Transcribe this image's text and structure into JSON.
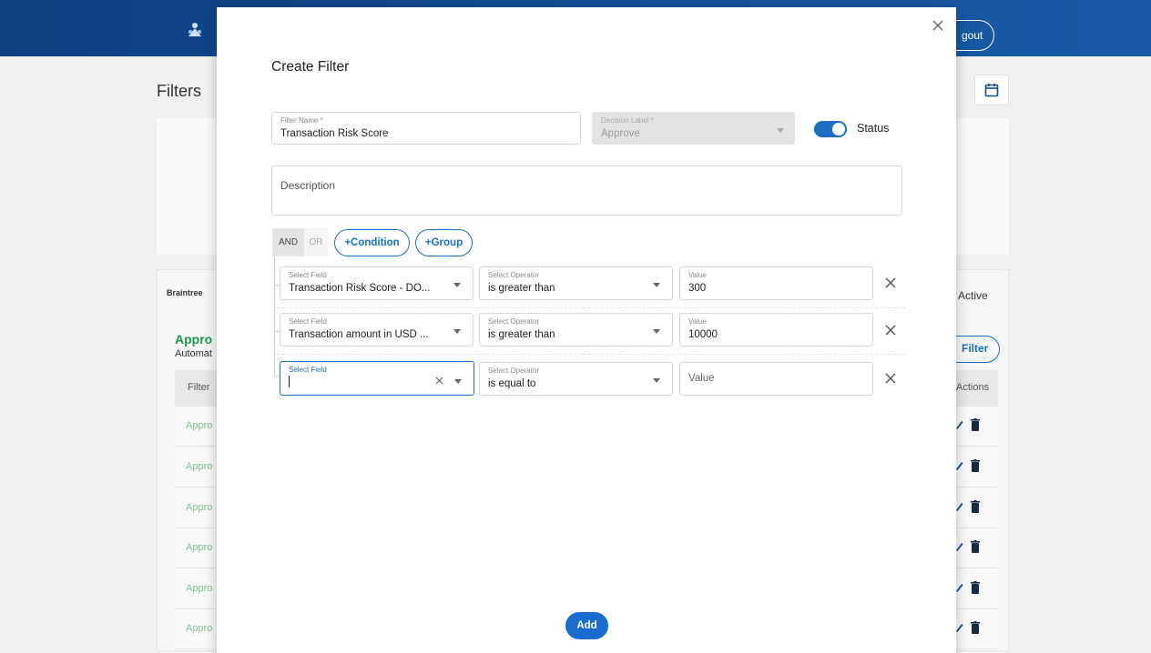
{
  "background": {
    "logout_label": "gout",
    "page_title": "Filters",
    "braintree_label": "Braintree",
    "active_label": "Active",
    "section_title": "Appro",
    "section_subtitle": "Automat",
    "filter_button": "Filter",
    "table_header_filter": "Filter",
    "table_header_actions": "Actions",
    "row_label": "Appro",
    "accent_green": "#1a9a4a",
    "header_blue": "#15539d"
  },
  "modal": {
    "title": "Create Filter",
    "filter_name": {
      "label": "Filter Name *",
      "value": "Transaction Risk Score"
    },
    "decision_label": {
      "label": "Decision Label *",
      "value": "Approve"
    },
    "status": {
      "label": "Status",
      "on": true
    },
    "description": {
      "placeholder": "Description"
    },
    "logic": {
      "and_label": "AND",
      "or_label": "OR",
      "selected": "AND"
    },
    "add_condition_label": "+Condition",
    "add_group_label": "+Group",
    "conditions": [
      {
        "field_label": "Select Field",
        "field_value": "Transaction Risk Score - DO...",
        "operator_label": "Select Operator",
        "operator_value": "is greater than",
        "value_label": "Value",
        "value": "300"
      },
      {
        "field_label": "Select Field",
        "field_value": "Transaction amount in USD ...",
        "operator_label": "Select Operator",
        "operator_value": "is greater than",
        "value_label": "Value",
        "value": "10000"
      },
      {
        "field_label": "Select Field",
        "field_value": "",
        "operator_label": "Select Operator",
        "operator_value": "is equal to",
        "value_placeholder": "Value"
      }
    ],
    "add_button": "Add",
    "primary_color": "#1a6fc4"
  }
}
